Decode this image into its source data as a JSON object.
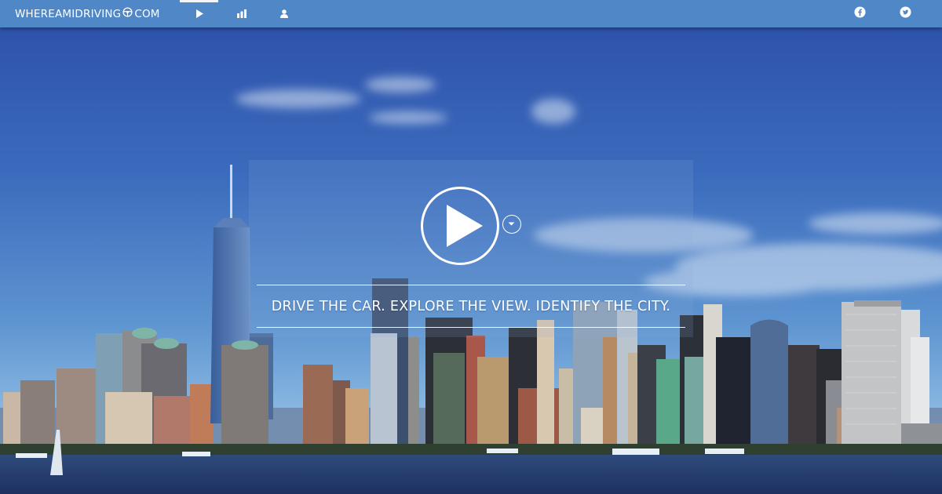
{
  "brand": {
    "name_left": "WHEREAMIDRIVING",
    "name_right": "COM",
    "logo_icon": "steering-wheel-icon"
  },
  "nav": [
    {
      "icon": "play-icon",
      "active": true
    },
    {
      "icon": "bar-chart-icon",
      "active": false
    },
    {
      "icon": "user-icon",
      "active": false
    }
  ],
  "social": [
    {
      "icon": "facebook-icon"
    },
    {
      "icon": "twitter-icon"
    }
  ],
  "hero": {
    "play_icon": "play-circle-icon",
    "more_icon": "chevron-down-circle-icon",
    "tagline": "DRIVE THE CAR. EXPLORE THE VIEW. IDENTIFY THE CITY."
  },
  "colors": {
    "topbar": "#5087c7",
    "sky_top": "#2b4fa6",
    "sky_bottom": "#7fb0dc",
    "water": "#233a66"
  }
}
